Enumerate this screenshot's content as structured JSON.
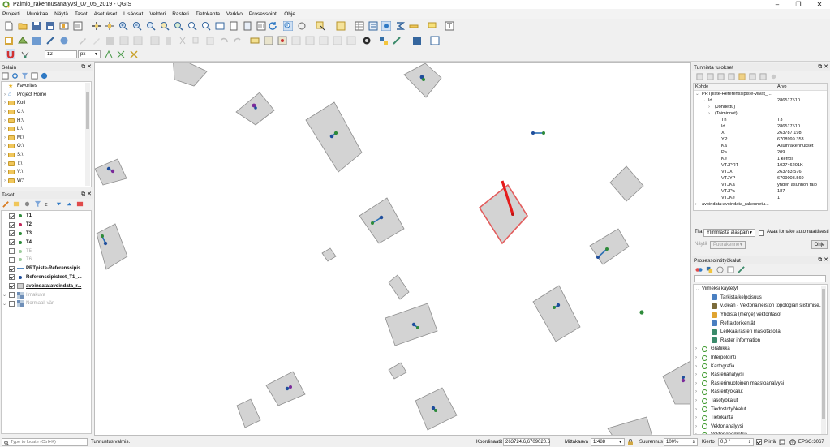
{
  "window": {
    "title": "Paimio_rakennusanalyysi_07_05_2019 - QGIS",
    "controls": [
      "–",
      "❐",
      "✕"
    ]
  },
  "menubar": [
    "Projekti",
    "Muokkaa",
    "Näytä",
    "Tasot",
    "Asetukset",
    "Lisäosat",
    "Vektori",
    "Rasteri",
    "Tietokanta",
    "Verkko",
    "Prosessointi",
    "Ohje"
  ],
  "toolbar": {
    "snapping_tolerance": "12",
    "snapping_unit": "px"
  },
  "browser": {
    "title": "Selain",
    "items": [
      {
        "label": "Favorites",
        "icon": "star-icon",
        "expand": false
      },
      {
        "label": "Project Home",
        "icon": "project-home-icon",
        "expand": true
      },
      {
        "label": "Koti",
        "icon": "folder-icon",
        "expand": true
      },
      {
        "label": "C:\\",
        "icon": "folder-icon",
        "expand": true
      },
      {
        "label": "H:\\",
        "icon": "folder-icon",
        "expand": true
      },
      {
        "label": "L:\\",
        "icon": "folder-icon",
        "expand": true
      },
      {
        "label": "M:\\",
        "icon": "folder-icon",
        "expand": true
      },
      {
        "label": "O:\\",
        "icon": "folder-icon",
        "expand": true
      },
      {
        "label": "S:\\",
        "icon": "folder-icon",
        "expand": true
      },
      {
        "label": "T:\\",
        "icon": "folder-icon",
        "expand": true
      },
      {
        "label": "V:\\",
        "icon": "folder-icon",
        "expand": true
      },
      {
        "label": "W:\\",
        "icon": "folder-icon",
        "expand": true
      }
    ]
  },
  "layers": {
    "title": "Tasot",
    "items": [
      {
        "label": "T1",
        "checked": true,
        "bold": true,
        "dim": false,
        "symbol": "point",
        "color": "#2e8b3a",
        "expand": false
      },
      {
        "label": "T2",
        "checked": true,
        "bold": true,
        "dim": false,
        "symbol": "point",
        "color": "#c0265a",
        "expand": false
      },
      {
        "label": "T3",
        "checked": true,
        "bold": true,
        "dim": false,
        "symbol": "point",
        "color": "#2e8b3a",
        "expand": false
      },
      {
        "label": "T4",
        "checked": true,
        "bold": true,
        "dim": false,
        "symbol": "point",
        "color": "#2e8b3a",
        "expand": false
      },
      {
        "label": "T5",
        "checked": false,
        "bold": false,
        "dim": true,
        "symbol": "point",
        "color": "#9ccc9c",
        "expand": false
      },
      {
        "label": "T6",
        "checked": false,
        "bold": false,
        "dim": true,
        "symbol": "point",
        "color": "#9ccc9c",
        "expand": false
      },
      {
        "label": "PRTpiste-Referenssipis...",
        "checked": true,
        "bold": true,
        "dim": false,
        "symbol": "line",
        "color": "#2b6fb5",
        "expand": false
      },
      {
        "label": "Referenssipisteet_T1_...",
        "checked": true,
        "bold": true,
        "dim": false,
        "symbol": "point",
        "color": "#1f4e9c",
        "expand": false
      },
      {
        "label": "avoindata:avoindata_r...",
        "checked": true,
        "bold": true,
        "dim": false,
        "symbol": "poly",
        "color": "#cfcfcf",
        "expand": false
      },
      {
        "label": "Ilmakuva",
        "checked": false,
        "bold": false,
        "dim": true,
        "symbol": "raster",
        "color": "#6f8fb8",
        "expand": true
      },
      {
        "label": "Normaali väri",
        "checked": false,
        "bold": false,
        "dim": true,
        "symbol": "raster",
        "color": "#6f8fb8",
        "expand": true
      }
    ]
  },
  "identify": {
    "title": "Tunnista tulokset",
    "col_feature": "Kohde",
    "col_value": "Arvo",
    "rows": [
      {
        "indent": 0,
        "arrow": "⌄",
        "key": "PRTpiste-Referenssipiste-viivat_...",
        "value": ""
      },
      {
        "indent": 1,
        "arrow": "⌄",
        "key": "Id",
        "value": "286517510"
      },
      {
        "indent": 2,
        "arrow": "›",
        "key": "(Johdettu)",
        "value": ""
      },
      {
        "indent": 2,
        "arrow": "›",
        "key": "(Toiminnot)",
        "value": ""
      },
      {
        "indent": 3,
        "arrow": "",
        "key": "Tn",
        "value": "T3"
      },
      {
        "indent": 3,
        "arrow": "",
        "key": "Id",
        "value": "286517510"
      },
      {
        "indent": 3,
        "arrow": "",
        "key": "XI",
        "value": "263787.198"
      },
      {
        "indent": 3,
        "arrow": "",
        "key": "YP",
        "value": "6708999.353"
      },
      {
        "indent": 3,
        "arrow": "",
        "key": "Kä",
        "value": "Asuinrakennukset"
      },
      {
        "indent": 3,
        "arrow": "",
        "key": "Pa",
        "value": "209"
      },
      {
        "indent": 3,
        "arrow": "",
        "key": "Ke",
        "value": "1 kerros"
      },
      {
        "indent": 3,
        "arrow": "",
        "key": "VTJPRT",
        "value": "102746201K"
      },
      {
        "indent": 3,
        "arrow": "",
        "key": "VTJXI",
        "value": "263783.576"
      },
      {
        "indent": 3,
        "arrow": "",
        "key": "VTJYP",
        "value": "6709008.560"
      },
      {
        "indent": 3,
        "arrow": "",
        "key": "VTJKä",
        "value": "yhden asunnon talo"
      },
      {
        "indent": 3,
        "arrow": "",
        "key": "VTJPa",
        "value": "187"
      },
      {
        "indent": 3,
        "arrow": "",
        "key": "VTJKe",
        "value": "1"
      },
      {
        "indent": 0,
        "arrow": "›",
        "key": "avoindata:avoindata_rakennetu...",
        "value": ""
      }
    ],
    "mode_label": "Tila",
    "mode_value": "Ylimmästä alaspäin",
    "auto_open_label": "Avaa lomake automaattisesti",
    "view_label": "Näytä",
    "view_value": "Puurakenne",
    "help_button": "Ohje"
  },
  "processing": {
    "title": "Prosessointityökalut",
    "recent_label": "Viimeksi käytetyt",
    "recent": [
      {
        "label": "Tarkista kelpoisuus",
        "color": "#4a7fc1"
      },
      {
        "label": "v.clean - Vektoriaineiston topologian siistimise...",
        "color": "#7b6b3a"
      },
      {
        "label": "Yhdistä (merge) vektoritasot",
        "color": "#e0a431"
      },
      {
        "label": "Refraktorikentät",
        "color": "#4a7fc1"
      },
      {
        "label": "Leikkaa rasteri maskitasolla",
        "color": "#3a8a6a"
      },
      {
        "label": "Raster information",
        "color": "#3a8a6a"
      }
    ],
    "groups": [
      "Grafiikka",
      "Interpolointi",
      "Kartografia",
      "Rasterianalyysi",
      "Rasterimuotoinen maastoanalyysi",
      "Rasterityökalut",
      "Tasotyökalut",
      "Tiedostotyökalut",
      "Tietokanta",
      "Vektorianalyysi",
      "Vektorigeometria"
    ]
  },
  "status": {
    "locator_placeholder": "Type to locate (Ctrl+K)",
    "message": "Tunnustus valmis.",
    "coord_label": "Koordinaatit",
    "coord_value": "263724.6,6709020.6",
    "scale_label": "Mittakaava",
    "scale_value": "1:488",
    "magnifier_label": "Suurennus",
    "magnifier_value": "100%",
    "rotation_label": "Kierto",
    "rotation_value": "0,0 °",
    "render_label": "Piirrä",
    "crs_value": "EPSG:3067"
  }
}
